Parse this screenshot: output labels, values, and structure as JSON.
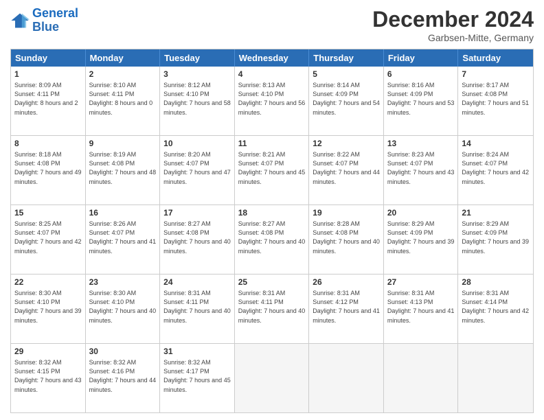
{
  "header": {
    "logo_general": "General",
    "logo_blue": "Blue",
    "month_title": "December 2024",
    "location": "Garbsen-Mitte, Germany"
  },
  "days_of_week": [
    "Sunday",
    "Monday",
    "Tuesday",
    "Wednesday",
    "Thursday",
    "Friday",
    "Saturday"
  ],
  "weeks": [
    [
      {
        "day": 1,
        "sunrise": "8:09 AM",
        "sunset": "4:11 PM",
        "daylight": "8 hours and 2 minutes"
      },
      {
        "day": 2,
        "sunrise": "8:10 AM",
        "sunset": "4:11 PM",
        "daylight": "8 hours and 0 minutes"
      },
      {
        "day": 3,
        "sunrise": "8:12 AM",
        "sunset": "4:10 PM",
        "daylight": "7 hours and 58 minutes"
      },
      {
        "day": 4,
        "sunrise": "8:13 AM",
        "sunset": "4:10 PM",
        "daylight": "7 hours and 56 minutes"
      },
      {
        "day": 5,
        "sunrise": "8:14 AM",
        "sunset": "4:09 PM",
        "daylight": "7 hours and 54 minutes"
      },
      {
        "day": 6,
        "sunrise": "8:16 AM",
        "sunset": "4:09 PM",
        "daylight": "7 hours and 53 minutes"
      },
      {
        "day": 7,
        "sunrise": "8:17 AM",
        "sunset": "4:08 PM",
        "daylight": "7 hours and 51 minutes"
      }
    ],
    [
      {
        "day": 8,
        "sunrise": "8:18 AM",
        "sunset": "4:08 PM",
        "daylight": "7 hours and 49 minutes"
      },
      {
        "day": 9,
        "sunrise": "8:19 AM",
        "sunset": "4:08 PM",
        "daylight": "7 hours and 48 minutes"
      },
      {
        "day": 10,
        "sunrise": "8:20 AM",
        "sunset": "4:07 PM",
        "daylight": "7 hours and 47 minutes"
      },
      {
        "day": 11,
        "sunrise": "8:21 AM",
        "sunset": "4:07 PM",
        "daylight": "7 hours and 45 minutes"
      },
      {
        "day": 12,
        "sunrise": "8:22 AM",
        "sunset": "4:07 PM",
        "daylight": "7 hours and 44 minutes"
      },
      {
        "day": 13,
        "sunrise": "8:23 AM",
        "sunset": "4:07 PM",
        "daylight": "7 hours and 43 minutes"
      },
      {
        "day": 14,
        "sunrise": "8:24 AM",
        "sunset": "4:07 PM",
        "daylight": "7 hours and 42 minutes"
      }
    ],
    [
      {
        "day": 15,
        "sunrise": "8:25 AM",
        "sunset": "4:07 PM",
        "daylight": "7 hours and 42 minutes"
      },
      {
        "day": 16,
        "sunrise": "8:26 AM",
        "sunset": "4:07 PM",
        "daylight": "7 hours and 41 minutes"
      },
      {
        "day": 17,
        "sunrise": "8:27 AM",
        "sunset": "4:08 PM",
        "daylight": "7 hours and 40 minutes"
      },
      {
        "day": 18,
        "sunrise": "8:27 AM",
        "sunset": "4:08 PM",
        "daylight": "7 hours and 40 minutes"
      },
      {
        "day": 19,
        "sunrise": "8:28 AM",
        "sunset": "4:08 PM",
        "daylight": "7 hours and 40 minutes"
      },
      {
        "day": 20,
        "sunrise": "8:29 AM",
        "sunset": "4:09 PM",
        "daylight": "7 hours and 39 minutes"
      },
      {
        "day": 21,
        "sunrise": "8:29 AM",
        "sunset": "4:09 PM",
        "daylight": "7 hours and 39 minutes"
      }
    ],
    [
      {
        "day": 22,
        "sunrise": "8:30 AM",
        "sunset": "4:10 PM",
        "daylight": "7 hours and 39 minutes"
      },
      {
        "day": 23,
        "sunrise": "8:30 AM",
        "sunset": "4:10 PM",
        "daylight": "7 hours and 40 minutes"
      },
      {
        "day": 24,
        "sunrise": "8:31 AM",
        "sunset": "4:11 PM",
        "daylight": "7 hours and 40 minutes"
      },
      {
        "day": 25,
        "sunrise": "8:31 AM",
        "sunset": "4:11 PM",
        "daylight": "7 hours and 40 minutes"
      },
      {
        "day": 26,
        "sunrise": "8:31 AM",
        "sunset": "4:12 PM",
        "daylight": "7 hours and 41 minutes"
      },
      {
        "day": 27,
        "sunrise": "8:31 AM",
        "sunset": "4:13 PM",
        "daylight": "7 hours and 41 minutes"
      },
      {
        "day": 28,
        "sunrise": "8:31 AM",
        "sunset": "4:14 PM",
        "daylight": "7 hours and 42 minutes"
      }
    ],
    [
      {
        "day": 29,
        "sunrise": "8:32 AM",
        "sunset": "4:15 PM",
        "daylight": "7 hours and 43 minutes"
      },
      {
        "day": 30,
        "sunrise": "8:32 AM",
        "sunset": "4:16 PM",
        "daylight": "7 hours and 44 minutes"
      },
      {
        "day": 31,
        "sunrise": "8:32 AM",
        "sunset": "4:17 PM",
        "daylight": "7 hours and 45 minutes"
      },
      null,
      null,
      null,
      null
    ]
  ]
}
